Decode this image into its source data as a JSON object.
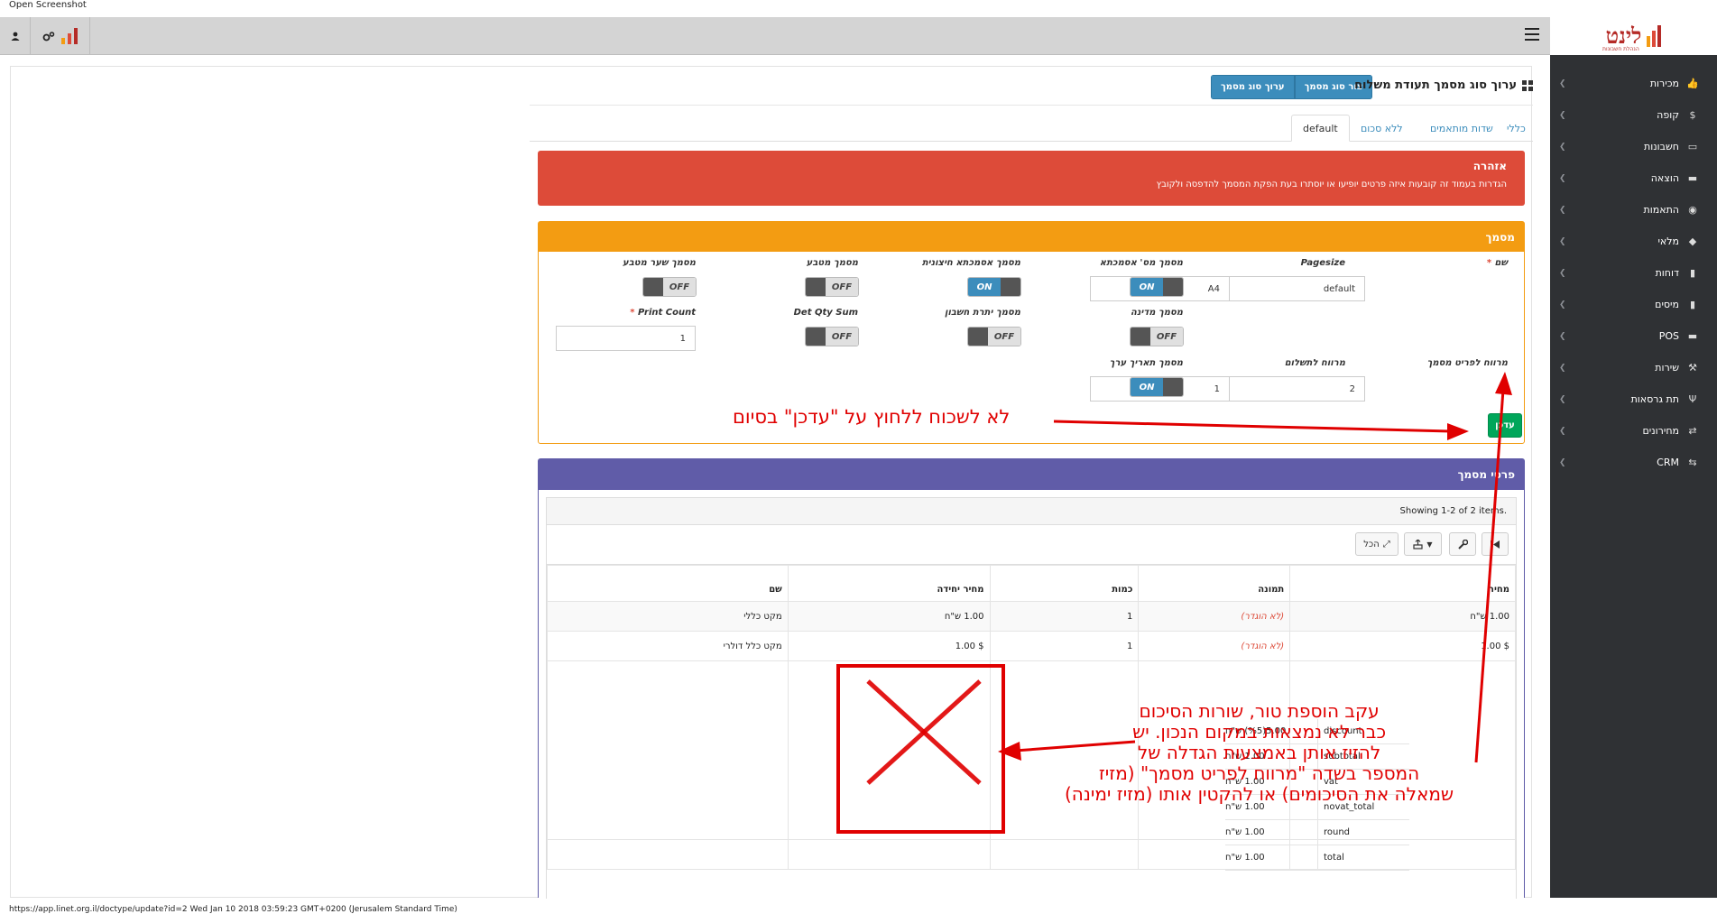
{
  "screenshot_title": "Open Screenshot",
  "status_url": "https://app.linet.org.il/doctype/update?id=2 Wed Jan 10 2018 03:59:23 GMT+0200 (Jerusalem Standard Time)",
  "logo": {
    "text": "לינט",
    "tagline": "הנהלת חשבונות"
  },
  "sidebar": {
    "items": [
      {
        "label": "מכירות",
        "icon": "thumbs-up-icon"
      },
      {
        "label": "קופה",
        "icon": "dollar-icon"
      },
      {
        "label": "חשבונות",
        "icon": "folder-open-icon"
      },
      {
        "label": "הוצאה",
        "icon": "cart-icon"
      },
      {
        "label": "התאמות",
        "icon": "eye-icon"
      },
      {
        "label": "מלאי",
        "icon": "tag-icon"
      },
      {
        "label": "דוחות",
        "icon": "bar-chart-icon"
      },
      {
        "label": "מיסים",
        "icon": "bar-chart-icon"
      },
      {
        "label": "POS",
        "icon": "cart-icon"
      },
      {
        "label": "שירות",
        "icon": "wrench-icon"
      },
      {
        "label": "תת גרסאות",
        "icon": "fork-icon"
      },
      {
        "label": "מחירונים",
        "icon": "arrows-icon"
      },
      {
        "label": "CRM",
        "icon": "shuffle-icon"
      }
    ]
  },
  "header": {
    "title": "ערוך סוג מסמך תעודת משלוח",
    "buttons": [
      "צור סוג מסמך",
      "ערוך סוג מסמך"
    ]
  },
  "tabs": [
    {
      "label": "כללי",
      "active": false
    },
    {
      "label": "שדות מותאמים",
      "active": false
    },
    {
      "label": "ללא סכום",
      "active": false
    },
    {
      "label": "default",
      "active": true
    }
  ],
  "alert": {
    "title": "אזהרה",
    "text": "הגדרות בעמוד זה קובעות איזה פרטים יופיעו או יוסתרו בעת הפקת המסמך להדפסה ולקובץ",
    "color": "#dd4b39"
  },
  "doc_panel": {
    "title": "מסמך",
    "color": "#f39c12",
    "fields": {
      "name_label": "שם",
      "name_value": "default",
      "pagesize_label": "Pagesize",
      "pagesize_value": "A4",
      "docnum_label": "מסמך מס' אסמכתא",
      "docnum_state": "ON",
      "extref_label": "מסמך אסמכתא חיצונית",
      "extref_state": "ON",
      "currency_label": "מסמך מטבע",
      "currency_state": "OFF",
      "rate_label": "מסמך שער מטבע",
      "rate_state": "OFF",
      "country_label": "מסמך מדינה",
      "country_state": "OFF",
      "balance_label": "מסמך יתרת חשבון",
      "balance_state": "OFF",
      "detqty_label": "Det Qty Sum",
      "detqty_state": "OFF",
      "printcount_label": "Print Count",
      "printcount_value": "1",
      "itemspace_label": "מרווח לפריט מסמך",
      "itemspace_value": "2",
      "payspace_label": "מרווח לתשלום",
      "payspace_value": "1",
      "valuedate_label": "מסמך תאריך ערך",
      "valuedate_state": "ON"
    },
    "update_button": "עדכן"
  },
  "items_panel": {
    "title": "פרטי מסמך",
    "color": "#605ca8",
    "summary": "Showing 1-2 of 2 items.",
    "all_button": "הכל",
    "columns": [
      "שם",
      "מחיר יחידה",
      "כמות",
      "תמונה",
      "מחיר"
    ],
    "rows": [
      {
        "name": "מקט כללי",
        "unit_price": "1.00 ש\"ח",
        "qty": "1",
        "image": "(לא הוגדר)",
        "price": "1.00 ש\"ח"
      },
      {
        "name": "מקט כלל דולרי",
        "unit_price": "$ 1.00",
        "qty": "1",
        "image": "(לא הוגדר)",
        "price": "$ 1.00"
      }
    ],
    "totals": [
      {
        "key": "discount",
        "value": "5.00(%5) ש\"ח"
      },
      {
        "key": "subtotal",
        "value": "1.00 ש\"ח"
      },
      {
        "key": "vat",
        "value": "1.00 ש\"ח"
      },
      {
        "key": "novat_total",
        "value": "1.00 ש\"ח"
      },
      {
        "key": "round",
        "value": "1.00 ש\"ח"
      },
      {
        "key": "total",
        "value": "1.00 ש\"ח"
      }
    ]
  },
  "annotations": {
    "update_note": "לא לשכוח ללחוץ על \"עדכן\" בסיום",
    "move_note_lines": [
      "עקב הוספת טור, שורות הסיכום",
      "כבר לא נמצאות במקום הנכון. יש",
      "להזיז אותן באמצעות הגדלה של",
      "המספר בשדה \"מרווח לפריט מסמך\"  (מזיז",
      "שמאלה את הסיכומים) או להקטין אותו (מזיז ימינה)"
    ],
    "color": "#e00000"
  }
}
